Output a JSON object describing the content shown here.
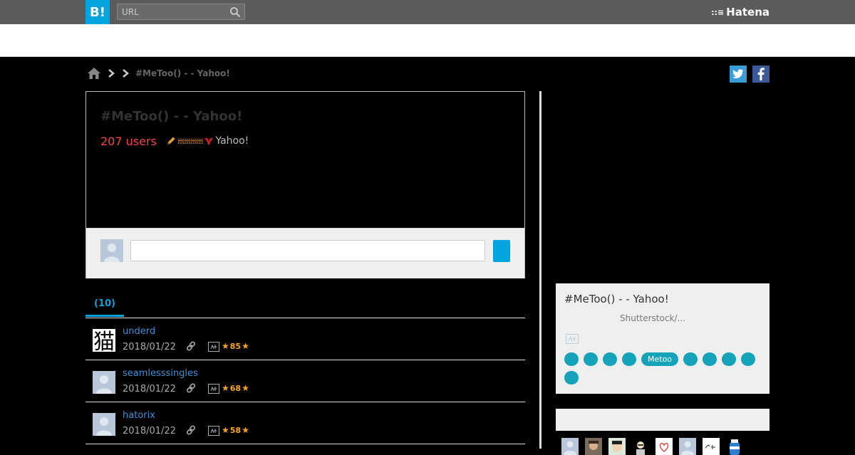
{
  "header": {
    "logo_text": "B!",
    "search_placeholder": "URL",
    "brand": "Hatena",
    "brand_mark": "::≡"
  },
  "breadcrumb": {
    "current": "#MeToo() -  - Yahoo!"
  },
  "entry": {
    "title": "#MeToo() -  - Yahoo!",
    "users": "207 users",
    "meta_icons": "𝍄𝍄𝍄𝍄",
    "domain": "Yahoo!"
  },
  "tabs": {
    "active_label": "(10)"
  },
  "bookmarks": [
    {
      "user": "underd",
      "date": "2018/01/22",
      "stars": "85",
      "avatar": "kanji"
    },
    {
      "user": "seamlesssingles",
      "date": "2018/01/22",
      "stars": "68",
      "avatar": "default"
    },
    {
      "user": "hatorix",
      "date": "2018/01/22",
      "stars": "58",
      "avatar": "default"
    }
  ],
  "avatar_kanji": "猫",
  "related": {
    "title": "#MeToo() -  - Yahoo!",
    "excerpt": "Shutterstock/...",
    "tags": [
      "",
      "",
      "",
      "",
      "Metoo",
      "",
      "",
      "",
      "",
      ""
    ]
  },
  "colors": {
    "accent": "#00a4de",
    "users_red": "#f2434b",
    "tag_teal": "#14a3b8",
    "star_orange": "#f5a623",
    "link_blue": "#3d8fd6"
  }
}
